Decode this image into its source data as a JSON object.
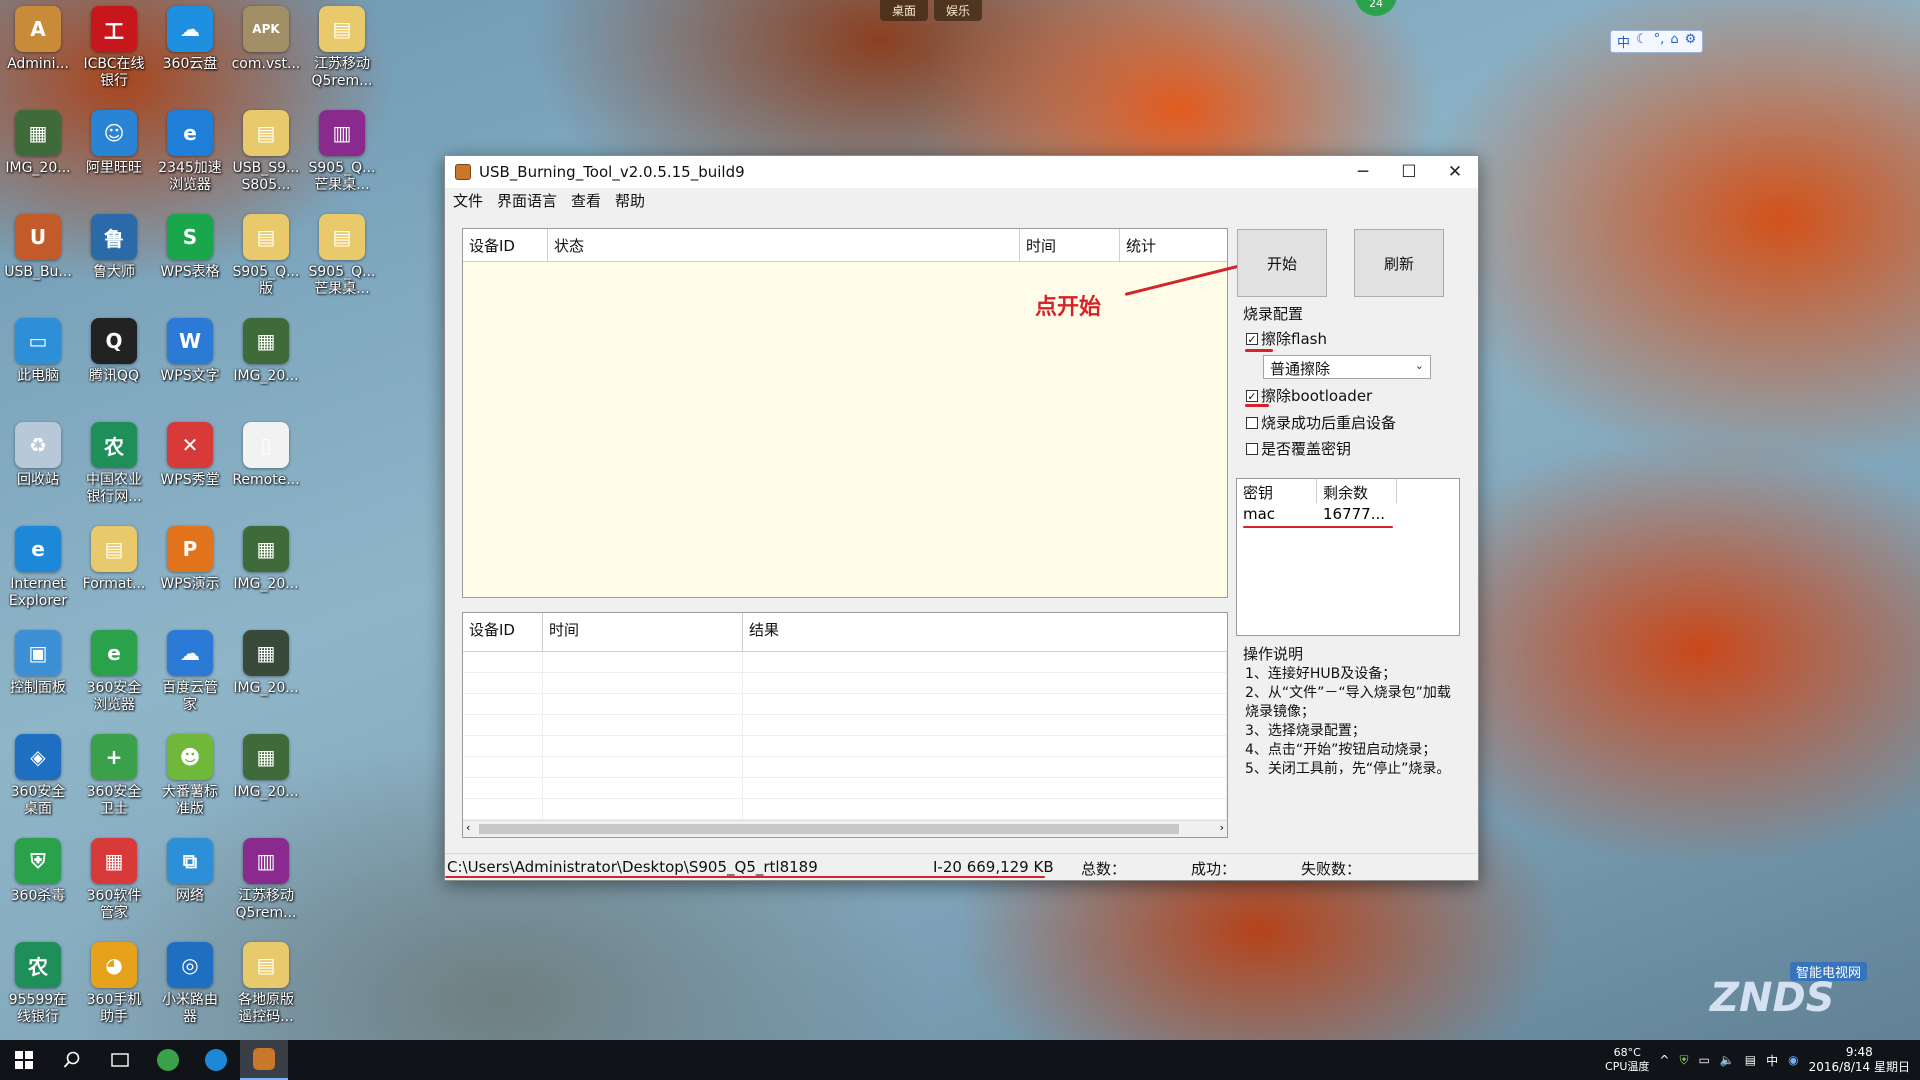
{
  "top_tabs": [
    "桌面",
    "娱乐"
  ],
  "ime": [
    "中",
    "☾",
    "°,",
    "⌂",
    "⚙"
  ],
  "notification_count": "24",
  "desktop_icons": [
    {
      "label": "Admini...",
      "color": "#c78b3a",
      "glyph": "A"
    },
    {
      "label": "ICBC在线\n银行",
      "color": "#c8161d",
      "glyph": "工"
    },
    {
      "label": "360云盘",
      "color": "#1f8fe0",
      "glyph": "☁"
    },
    {
      "label": "com.vst...",
      "color": "#a28f66",
      "glyph": "APK"
    },
    {
      "label": "江苏移动\nQ5rem...",
      "color": "#e8c96c",
      "glyph": "▤"
    },
    {
      "label": "IMG_20...",
      "color": "#3f6b3a",
      "glyph": "▦"
    },
    {
      "label": "阿里旺旺",
      "color": "#2a84d6",
      "glyph": "☺"
    },
    {
      "label": "2345加速\n浏览器",
      "color": "#1f7fd8",
      "glyph": "e"
    },
    {
      "label": "USB_S9...\nS805...",
      "color": "#e8c96c",
      "glyph": "▤"
    },
    {
      "label": "S905_Q...\n芒果桌...",
      "color": "#8a2a8f",
      "glyph": "▥"
    },
    {
      "label": "USB_Bu...",
      "color": "#c35a2a",
      "glyph": "U"
    },
    {
      "label": "鲁大师",
      "color": "#2b6aa8",
      "glyph": "鲁"
    },
    {
      "label": "WPS表格",
      "color": "#1aa64a",
      "glyph": "S"
    },
    {
      "label": "S905_Q...\n版",
      "color": "#e8c96c",
      "glyph": "▤"
    },
    {
      "label": "S905_Q...\n芒果桌...",
      "color": "#e8c96c",
      "glyph": "▤"
    },
    {
      "label": "此电脑",
      "color": "#2c8fd8",
      "glyph": "▭"
    },
    {
      "label": "腾讯QQ",
      "color": "#222222",
      "glyph": "Q"
    },
    {
      "label": "WPS文字",
      "color": "#2a7ad6",
      "glyph": "W"
    },
    {
      "label": "IMG_20...",
      "color": "#3f6b3a",
      "glyph": "▦"
    },
    {
      "label": "",
      "color": "transparent",
      "glyph": ""
    },
    {
      "label": "回收站",
      "color": "#b7c9d8",
      "glyph": "♻"
    },
    {
      "label": "中国农业\n银行网...",
      "color": "#1f8f5a",
      "glyph": "农"
    },
    {
      "label": "WPS秀堂",
      "color": "#d83a3a",
      "glyph": "✕"
    },
    {
      "label": "Remote...",
      "color": "#f2f2f2",
      "glyph": "▯"
    },
    {
      "label": "",
      "color": "transparent",
      "glyph": ""
    },
    {
      "label": "Internet\nExplorer",
      "color": "#1e88d8",
      "glyph": "e"
    },
    {
      "label": "Format...",
      "color": "#e8c96c",
      "glyph": "▤"
    },
    {
      "label": "WPS演示",
      "color": "#e2731d",
      "glyph": "P"
    },
    {
      "label": "IMG_20...",
      "color": "#3f6b3a",
      "glyph": "▦"
    },
    {
      "label": "",
      "color": "transparent",
      "glyph": ""
    },
    {
      "label": "控制面板",
      "color": "#3d8fd6",
      "glyph": "▣"
    },
    {
      "label": "360安全\n浏览器",
      "color": "#2aa14b",
      "glyph": "e"
    },
    {
      "label": "百度云管\n家",
      "color": "#2a7ad6",
      "glyph": "☁"
    },
    {
      "label": "IMG_20...",
      "color": "#3a4a3a",
      "glyph": "▦"
    },
    {
      "label": "",
      "color": "transparent",
      "glyph": ""
    },
    {
      "label": "360安全\n桌面",
      "color": "#1e6fc2",
      "glyph": "◈"
    },
    {
      "label": "360安全\n卫士",
      "color": "#3aa14a",
      "glyph": "+"
    },
    {
      "label": "大番薯标\n准版",
      "color": "#6fb83a",
      "glyph": "☻"
    },
    {
      "label": "IMG_20...",
      "color": "#3f6b3a",
      "glyph": "▦"
    },
    {
      "label": "",
      "color": "transparent",
      "glyph": ""
    },
    {
      "label": "360杀毒",
      "color": "#2aa14b",
      "glyph": "⛨"
    },
    {
      "label": "360软件\n管家",
      "color": "#d83a3a",
      "glyph": "▦"
    },
    {
      "label": "网络",
      "color": "#2c8fd8",
      "glyph": "⧉"
    },
    {
      "label": "江苏移动\nQ5rem...",
      "color": "#8a2a8f",
      "glyph": "▥"
    },
    {
      "label": "",
      "color": "transparent",
      "glyph": ""
    },
    {
      "label": "95599在\n线银行",
      "color": "#1f8f5a",
      "glyph": "农"
    },
    {
      "label": "360手机\n助手",
      "color": "#e6a21d",
      "glyph": "◕"
    },
    {
      "label": "小米路由\n器",
      "color": "#1e6fc2",
      "glyph": "◎"
    },
    {
      "label": "各地原版\n遥控码...",
      "color": "#e8c96c",
      "glyph": "▤"
    }
  ],
  "window": {
    "title": "USB_Burning_Tool_v2.0.5.15_build9",
    "controls": {
      "minimize": "─",
      "maximize": "☐",
      "close": "✕"
    },
    "menu": [
      "文件",
      "界面语言",
      "查看",
      "帮助"
    ],
    "top_table": {
      "headers": [
        "设备ID",
        "状态",
        "时间",
        "统计"
      ]
    },
    "bottom_table": {
      "headers": [
        "设备ID",
        "时间",
        "结果"
      ]
    },
    "start_button": "开始",
    "refresh_button": "刷新",
    "config": {
      "group_label": "烧录配置",
      "erase_flash": {
        "label": "擦除flash",
        "checked": true
      },
      "erase_mode": "普通擦除",
      "erase_bootloader": {
        "label": "擦除bootloader",
        "checked": true
      },
      "reboot_after": {
        "label": "烧录成功后重启设备",
        "checked": false
      },
      "overwrite_key": {
        "label": "是否覆盖密钥",
        "checked": false
      }
    },
    "key_table": {
      "headers": [
        "密钥",
        "剩余数"
      ],
      "rows": [
        [
          "mac",
          "16777..."
        ]
      ]
    },
    "instructions": {
      "group_label": "操作说明",
      "lines": [
        "1、连接好HUB及设备；",
        "2、从“文件”－“导入烧录包”加载烧录镜像；",
        "3、选择烧录配置；",
        "4、点击“开始”按钮启动烧录；",
        "5、关闭工具前，先“停止”烧录。"
      ]
    },
    "status": {
      "path": "C:\\Users\\Administrator\\Desktop\\S905_Q5_rtl8189",
      "size": "I-20 669,129 KB",
      "total_label": "总数：",
      "success_label": "成功：",
      "fail_label": "失败数："
    }
  },
  "annotation": {
    "text": "点开始",
    "color": "#d4232a"
  },
  "taskbar": {
    "temp": "68°C",
    "temp_label": "CPU温度",
    "ime": "中",
    "time": "9:48",
    "date": "2016/8/14 星期日"
  },
  "watermark": {
    "text": "ZNDS",
    "sub": "智能电视网"
  }
}
